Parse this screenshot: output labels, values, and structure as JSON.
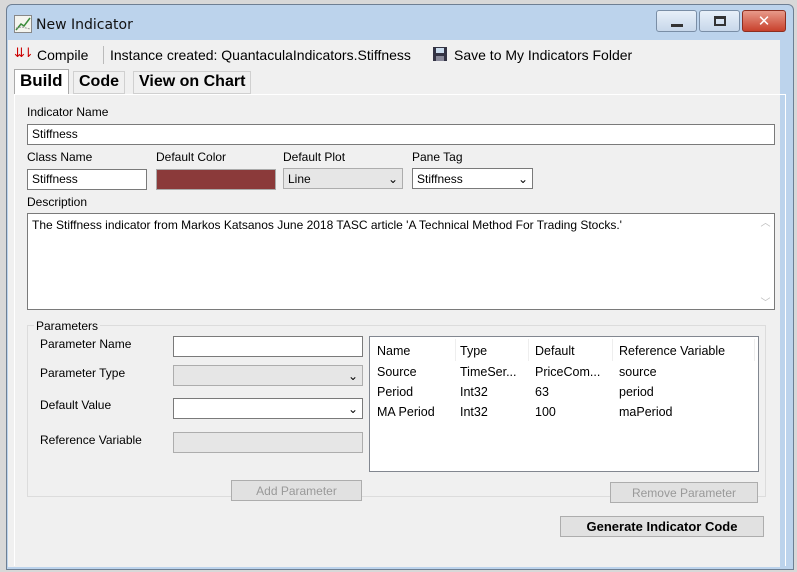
{
  "window": {
    "title": "New Indicator",
    "icon": "chart-line-icon"
  },
  "toolbar": {
    "compile": "Compile",
    "status": "Instance created: QuantaculaIndicators.Stiffness",
    "save": "Save to My Indicators Folder"
  },
  "tabs": [
    {
      "label": "Build",
      "active": true
    },
    {
      "label": "Code"
    },
    {
      "label": "View on Chart"
    }
  ],
  "build": {
    "indicator_name_label": "Indicator Name",
    "indicator_name": "Stiffness",
    "class_name_label": "Class Name",
    "class_name": "Stiffness",
    "default_color_label": "Default Color",
    "default_color": "#8b3a3a",
    "default_plot_label": "Default Plot",
    "default_plot": "Line",
    "pane_tag_label": "Pane Tag",
    "pane_tag": "Stiffness",
    "description_label": "Description",
    "description": "The Stiffness indicator from Markos Katsanos June 2018 TASC article 'A Technical Method For Trading Stocks.'"
  },
  "parameters": {
    "group_label": "Parameters",
    "name_label": "Parameter Name",
    "type_label": "Parameter Type",
    "default_label": "Default Value",
    "ref_label": "Reference Variable",
    "add_button": "Add Parameter",
    "remove_button": "Remove Parameter",
    "columns": [
      "Name",
      "Type",
      "Default",
      "Reference Variable"
    ],
    "rows": [
      [
        "Source",
        "TimeSer...",
        "PriceCom...",
        "source"
      ],
      [
        "Period",
        "Int32",
        "63",
        "period"
      ],
      [
        "MA Period",
        "Int32",
        "100",
        "maPeriod"
      ]
    ]
  },
  "generate_button": "Generate Indicator Code"
}
